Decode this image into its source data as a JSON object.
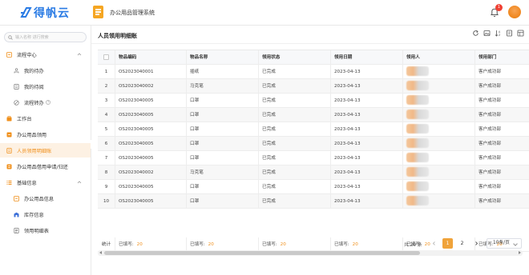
{
  "header": {
    "logo_text": "得帆云",
    "system_title": "办公用品管理系统",
    "notification_count": "1"
  },
  "sidebar": {
    "search_placeholder": "输入名称 进行搜索",
    "items": [
      {
        "label": "流程中心",
        "icon": "flow-icon"
      },
      {
        "label": "我的待办",
        "icon": "todo-icon"
      },
      {
        "label": "我的待阅",
        "icon": "read-icon"
      },
      {
        "label": "流程转办",
        "icon": "transfer-icon"
      },
      {
        "label": "工作台",
        "icon": "workbench-icon"
      },
      {
        "label": "办公用品领用",
        "icon": "receive-icon"
      },
      {
        "label": "人员领用明细账",
        "icon": "ledger-icon"
      },
      {
        "label": "办公用品借用申请/归还",
        "icon": "borrow-icon"
      },
      {
        "label": "基础信息",
        "icon": "list-icon"
      },
      {
        "label": "办公用品信息",
        "icon": "info-icon"
      },
      {
        "label": "库存信息",
        "icon": "stock-icon"
      },
      {
        "label": "领用明细表",
        "icon": "detail-icon"
      }
    ]
  },
  "main": {
    "title": "人员领用明细账",
    "toolbar_icons": [
      "refresh-icon",
      "image-icon",
      "sort-icon",
      "export-icon",
      "column-settings-icon"
    ]
  },
  "table": {
    "columns": [
      "物品编码",
      "物品名称",
      "领用状态",
      "领用日期",
      "领用人",
      "领用部门"
    ],
    "rows": [
      {
        "no": "1",
        "code": "OS2023040001",
        "name": "插纸",
        "status": "已完成",
        "date": "2023-04-13",
        "dept": "客户成功部"
      },
      {
        "no": "2",
        "code": "OS2023040002",
        "name": "马克笔",
        "status": "已完成",
        "date": "2023-04-13",
        "dept": "客户成功部"
      },
      {
        "no": "3",
        "code": "OS2023040005",
        "name": "口罩",
        "status": "已完成",
        "date": "2023-04-13",
        "dept": "客户成功部"
      },
      {
        "no": "4",
        "code": "OS2023040005",
        "name": "口罩",
        "status": "已完成",
        "date": "2023-04-13",
        "dept": "客户成功部"
      },
      {
        "no": "5",
        "code": "OS2023040005",
        "name": "口罩",
        "status": "已完成",
        "date": "2023-04-13",
        "dept": "客户成功部"
      },
      {
        "no": "6",
        "code": "OS2023040005",
        "name": "口罩",
        "status": "已完成",
        "date": "2023-04-13",
        "dept": "客户成功部"
      },
      {
        "no": "7",
        "code": "OS2023040005",
        "name": "口罩",
        "status": "已完成",
        "date": "2023-04-13",
        "dept": "客户成功部"
      },
      {
        "no": "8",
        "code": "OS2023040002",
        "name": "马克笔",
        "status": "已完成",
        "date": "2023-04-13",
        "dept": "客户成功部"
      },
      {
        "no": "9",
        "code": "OS2023040005",
        "name": "口罩",
        "status": "已完成",
        "date": "2023-04-13",
        "dept": "客户成功部"
      },
      {
        "no": "10",
        "code": "OS2023040005",
        "name": "口罩",
        "status": "已完成",
        "date": "2023-04-13",
        "dept": "客户成功部"
      }
    ],
    "footer": {
      "label": "统计",
      "filled_label": "已填写:",
      "c1": "20",
      "c2": "20",
      "c3": "20",
      "c4": "20",
      "c5": "20",
      "c6": "20"
    }
  },
  "pagination": {
    "total": "共 20 条",
    "pages": [
      "1",
      "2"
    ],
    "current": "1",
    "page_size": "10条/页"
  },
  "colors": {
    "accent": "#f0901c",
    "active_bg": "#fdf1e3",
    "logo": "#2a7be4",
    "badge": "#f04134"
  }
}
